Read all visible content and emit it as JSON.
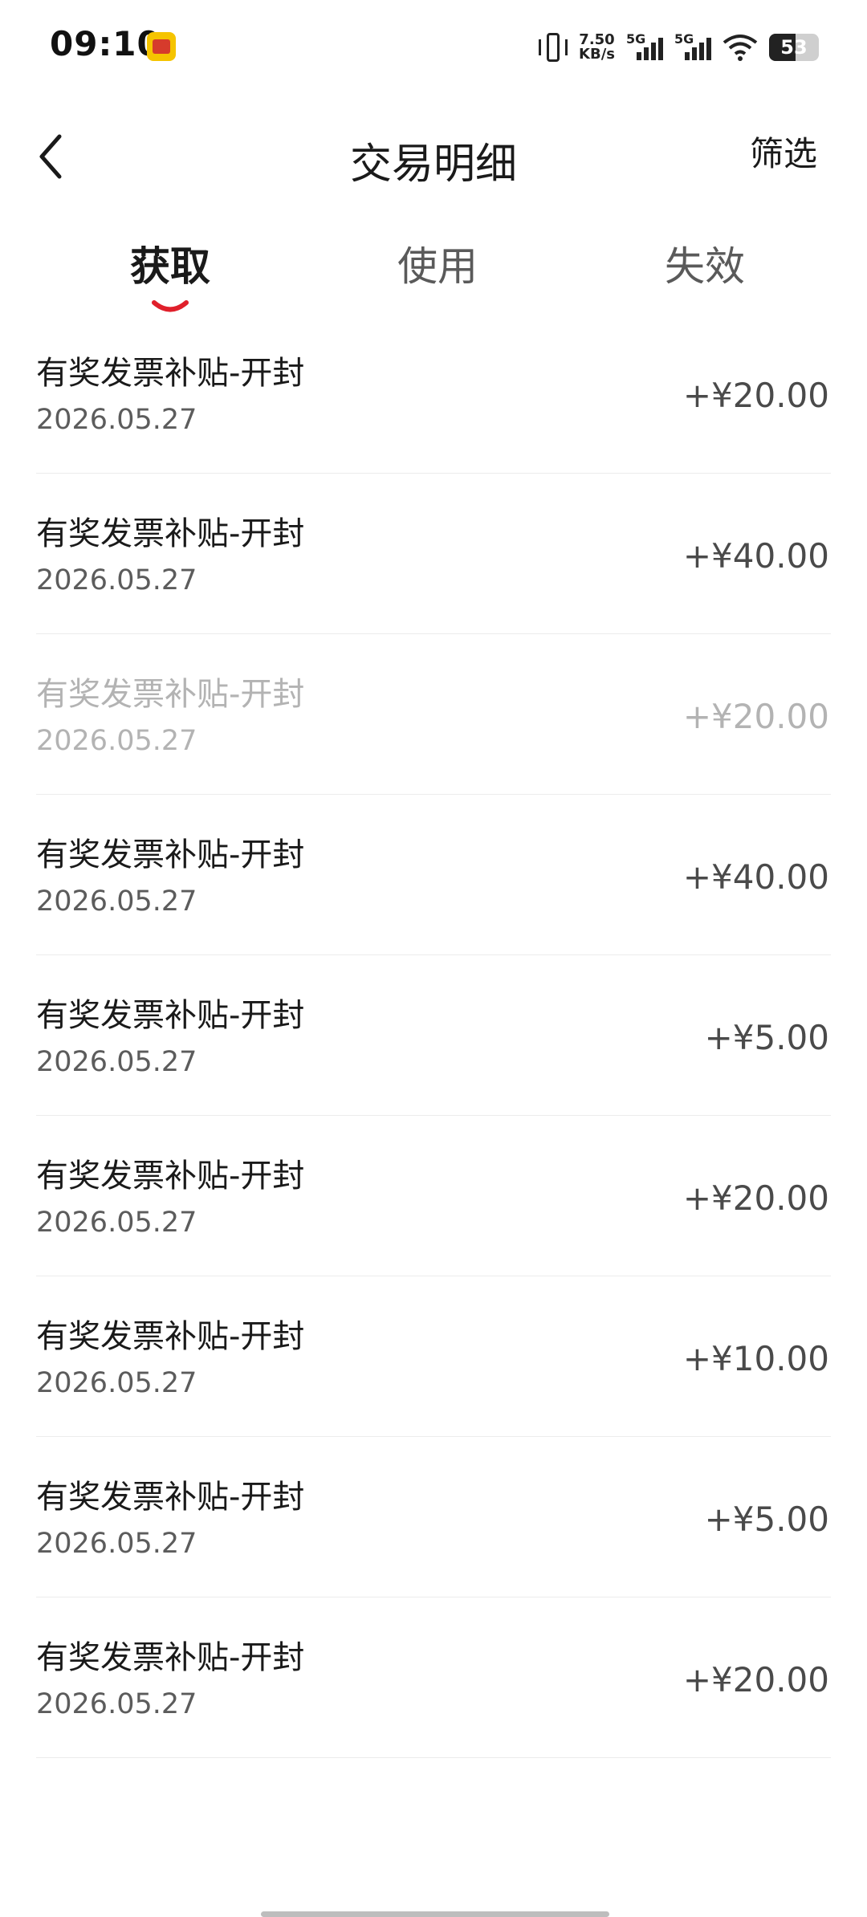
{
  "status_bar": {
    "time": "09:10",
    "net_speed_value": "7.50",
    "net_speed_unit": "KB/s",
    "sim1_label": "5G",
    "sim2_label": "5G",
    "battery": "53"
  },
  "header": {
    "title": "交易明细",
    "filter_label": "筛选"
  },
  "tabs": [
    {
      "label": "获取",
      "active": true
    },
    {
      "label": "使用",
      "active": false
    },
    {
      "label": "失效",
      "active": false
    }
  ],
  "accent_color": "#e0202b",
  "transactions": [
    {
      "name": "有奖发票补贴-开封",
      "date": "2026.05.27",
      "amount": "+¥20.00"
    },
    {
      "name": "有奖发票补贴-开封",
      "date": "2026.05.27",
      "amount": "+¥40.00"
    },
    {
      "name": "有奖发票补贴-开封",
      "date": "2026.05.27",
      "amount": "+¥20.00",
      "dimmed": true
    },
    {
      "name": "有奖发票补贴-开封",
      "date": "2026.05.27",
      "amount": "+¥40.00"
    },
    {
      "name": "有奖发票补贴-开封",
      "date": "2026.05.27",
      "amount": "+¥5.00"
    },
    {
      "name": "有奖发票补贴-开封",
      "date": "2026.05.27",
      "amount": "+¥20.00"
    },
    {
      "name": "有奖发票补贴-开封",
      "date": "2026.05.27",
      "amount": "+¥10.00"
    },
    {
      "name": "有奖发票补贴-开封",
      "date": "2026.05.27",
      "amount": "+¥5.00"
    },
    {
      "name": "有奖发票补贴-开封",
      "date": "2026.05.27",
      "amount": "+¥20.00"
    }
  ]
}
